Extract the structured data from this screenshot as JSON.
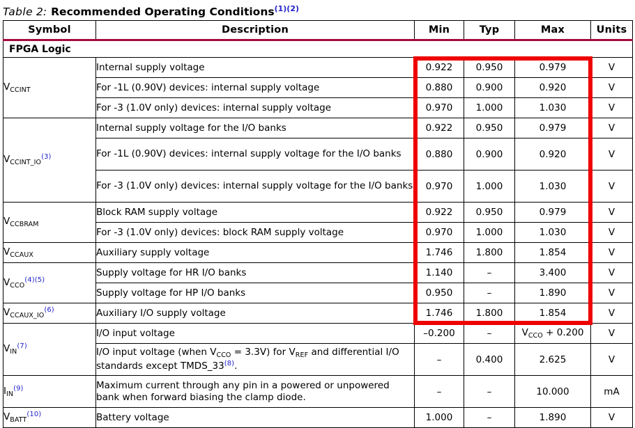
{
  "caption": {
    "label": "Table",
    "number": "2:",
    "title": "Recommended Operating Conditions",
    "footnotes": "(1)(2)"
  },
  "colors": {
    "header_rule": "#a30b40",
    "footnote_blue": "#2222cc",
    "annotation_red": "#ee0000"
  },
  "table": {
    "columns": [
      "Symbol",
      "Description",
      "Min",
      "Typ",
      "Max",
      "Units"
    ],
    "section_label": "FPGA Logic",
    "rows": [
      {
        "symbol": "V",
        "symbol_sub": "CCINT",
        "symbol_fn": "",
        "description": "Internal supply voltage",
        "min": "0.922",
        "typ": "0.950",
        "max": "0.979",
        "units": "V"
      },
      {
        "symbol": "",
        "symbol_sub": "",
        "symbol_fn": "",
        "description": "For -1L (0.90V) devices: internal supply voltage",
        "min": "0.880",
        "typ": "0.900",
        "max": "0.920",
        "units": "V"
      },
      {
        "symbol": "",
        "symbol_sub": "",
        "symbol_fn": "",
        "description": "For -3 (1.0V only) devices: internal supply voltage",
        "min": "0.970",
        "typ": "1.000",
        "max": "1.030",
        "units": "V"
      },
      {
        "symbol": "V",
        "symbol_sub": "CCINT_IO",
        "symbol_fn": "(3)",
        "description": "Internal supply voltage for the I/O banks",
        "min": "0.922",
        "typ": "0.950",
        "max": "0.979",
        "units": "V"
      },
      {
        "symbol": "",
        "symbol_sub": "",
        "symbol_fn": "",
        "description": "For -1L (0.90V) devices: internal supply voltage for the I/O banks",
        "min": "0.880",
        "typ": "0.900",
        "max": "0.920",
        "units": "V"
      },
      {
        "symbol": "",
        "symbol_sub": "",
        "symbol_fn": "",
        "description": "For -3 (1.0V only) devices: internal supply voltage for the I/O banks",
        "min": "0.970",
        "typ": "1.000",
        "max": "1.030",
        "units": "V"
      },
      {
        "symbol": "V",
        "symbol_sub": "CCBRAM",
        "symbol_fn": "",
        "description": "Block RAM supply voltage",
        "min": "0.922",
        "typ": "0.950",
        "max": "0.979",
        "units": "V"
      },
      {
        "symbol": "",
        "symbol_sub": "",
        "symbol_fn": "",
        "description": "For -3 (1.0V only) devices: block RAM supply voltage",
        "min": "0.970",
        "typ": "1.000",
        "max": "1.030",
        "units": "V"
      },
      {
        "symbol": "V",
        "symbol_sub": "CCAUX",
        "symbol_fn": "",
        "description": "Auxiliary supply voltage",
        "min": "1.746",
        "typ": "1.800",
        "max": "1.854",
        "units": "V"
      },
      {
        "symbol": "V",
        "symbol_sub": "CCO",
        "symbol_fn": "(4)(5)",
        "description": "Supply voltage for HR I/O banks",
        "min": "1.140",
        "typ": "–",
        "max": "3.400",
        "units": "V"
      },
      {
        "symbol": "",
        "symbol_sub": "",
        "symbol_fn": "",
        "description": "Supply voltage for HP I/O banks",
        "min": "0.950",
        "typ": "–",
        "max": "1.890",
        "units": "V"
      },
      {
        "symbol": "V",
        "symbol_sub": "CCAUX_IO",
        "symbol_fn": "(6)",
        "description": "Auxiliary I/O supply voltage",
        "min": "1.746",
        "typ": "1.800",
        "max": "1.854",
        "units": "V"
      },
      {
        "symbol": "V",
        "symbol_sub": "IN",
        "symbol_fn": "(7)",
        "description": "I/O input voltage",
        "min": "–0.200",
        "typ": "–",
        "max": "V_CCO + 0.200",
        "units": "V"
      },
      {
        "symbol": "",
        "symbol_sub": "",
        "symbol_fn": "",
        "description": "I/O input voltage (when V_CCO = 3.3V) for V_REF and differential I/O standards except TMDS_33(8).",
        "min": "–",
        "typ": "0.400",
        "max": "2.625",
        "units": "V"
      },
      {
        "symbol": "I",
        "symbol_sub": "IN",
        "symbol_fn": "(9)",
        "description": "Maximum current through any pin in a powered or unpowered bank when forward biasing the clamp diode.",
        "min": "–",
        "typ": "–",
        "max": "10.000",
        "units": "mA"
      },
      {
        "symbol": "V",
        "symbol_sub": "BATT",
        "symbol_fn": "(10)",
        "description": "Battery voltage",
        "min": "1.000",
        "typ": "–",
        "max": "1.890",
        "units": "V"
      }
    ]
  },
  "annotation": {
    "name": "red-highlight-rectangle",
    "covers_columns": [
      "Min",
      "Typ",
      "Max"
    ],
    "covers_rows_from": "Internal supply voltage",
    "covers_rows_to": "Auxiliary I/O supply voltage"
  }
}
